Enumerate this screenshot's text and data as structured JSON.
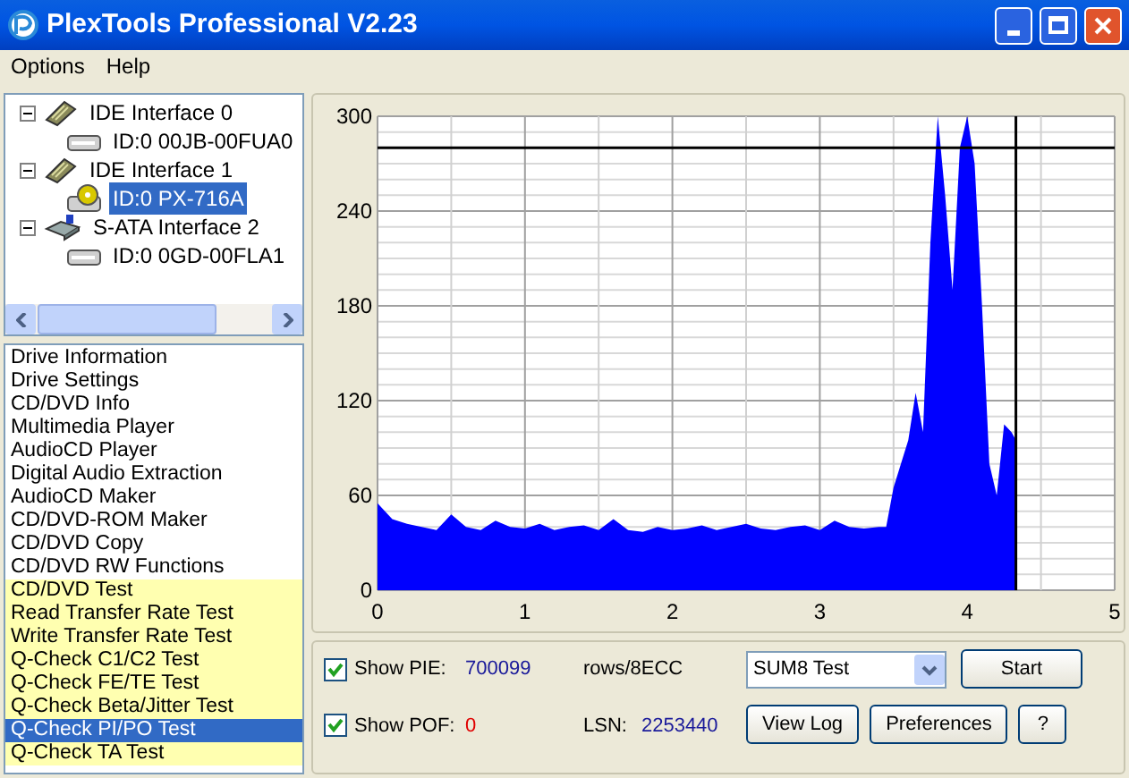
{
  "window": {
    "title": "PlexTools Professional V2.23"
  },
  "menu": [
    "Options",
    "Help"
  ],
  "tree": [
    {
      "label": "IDE Interface 0",
      "kind": "ide",
      "expanded": true,
      "children": [
        {
          "label": "ID:0  00JB-00FUA0",
          "kind": "disk",
          "selected": false
        }
      ]
    },
    {
      "label": "IDE Interface 1",
      "kind": "ide",
      "expanded": true,
      "children": [
        {
          "label": "ID:0  PX-716A",
          "kind": "optical",
          "selected": true
        }
      ]
    },
    {
      "label": "S-ATA Interface 2",
      "kind": "sata",
      "expanded": true,
      "children": [
        {
          "label": "ID:0  0GD-00FLA1",
          "kind": "disk",
          "selected": false
        }
      ]
    }
  ],
  "functions": [
    {
      "label": "Drive Information",
      "highlighted": false,
      "selected": false
    },
    {
      "label": "Drive Settings",
      "highlighted": false,
      "selected": false
    },
    {
      "label": "CD/DVD Info",
      "highlighted": false,
      "selected": false
    },
    {
      "label": "Multimedia Player",
      "highlighted": false,
      "selected": false
    },
    {
      "label": "AudioCD Player",
      "highlighted": false,
      "selected": false
    },
    {
      "label": "Digital Audio Extraction",
      "highlighted": false,
      "selected": false
    },
    {
      "label": "AudioCD Maker",
      "highlighted": false,
      "selected": false
    },
    {
      "label": "CD/DVD-ROM Maker",
      "highlighted": false,
      "selected": false
    },
    {
      "label": "CD/DVD Copy",
      "highlighted": false,
      "selected": false
    },
    {
      "label": "CD/DVD RW Functions",
      "highlighted": false,
      "selected": false
    },
    {
      "label": "CD/DVD Test",
      "highlighted": true,
      "selected": false
    },
    {
      "label": "Read Transfer Rate Test",
      "highlighted": true,
      "selected": false
    },
    {
      "label": "Write Transfer Rate Test",
      "highlighted": true,
      "selected": false
    },
    {
      "label": "Q-Check C1/C2 Test",
      "highlighted": true,
      "selected": false
    },
    {
      "label": "Q-Check FE/TE Test",
      "highlighted": true,
      "selected": false
    },
    {
      "label": "Q-Check Beta/Jitter Test",
      "highlighted": true,
      "selected": false
    },
    {
      "label": "Q-Check PI/PO Test",
      "selected": true
    },
    {
      "label": "Q-Check TA Test",
      "highlighted": true,
      "selected": false
    }
  ],
  "chart_data": {
    "type": "area",
    "x": [
      0,
      0.1,
      0.2,
      0.3,
      0.4,
      0.5,
      0.6,
      0.7,
      0.8,
      0.9,
      1,
      1.1,
      1.2,
      1.3,
      1.4,
      1.5,
      1.6,
      1.7,
      1.8,
      1.9,
      2,
      2.1,
      2.2,
      2.3,
      2.4,
      2.5,
      2.6,
      2.7,
      2.8,
      2.9,
      3,
      3.1,
      3.2,
      3.3,
      3.4,
      3.45,
      3.5,
      3.55,
      3.6,
      3.65,
      3.7,
      3.75,
      3.8,
      3.85,
      3.9,
      3.95,
      4,
      4.05,
      4.1,
      4.15,
      4.2,
      4.25,
      4.3,
      4.33
    ],
    "series": [
      {
        "color": "#0000ff",
        "values": [
          55,
          45,
          42,
          40,
          38,
          48,
          40,
          38,
          44,
          40,
          39,
          42,
          38,
          40,
          41,
          38,
          45,
          38,
          37,
          40,
          38,
          39,
          41,
          38,
          40,
          42,
          39,
          38,
          40,
          41,
          38,
          44,
          40,
          39,
          40,
          40,
          65,
          80,
          95,
          125,
          100,
          220,
          300,
          250,
          190,
          280,
          300,
          270,
          180,
          80,
          60,
          105,
          100,
          95
        ]
      }
    ],
    "xlim": [
      0,
      5
    ],
    "ylim": [
      0,
      300
    ],
    "xticks": [
      0,
      1,
      2,
      3,
      4,
      5
    ],
    "yticks": [
      0,
      60,
      120,
      180,
      240,
      300
    ],
    "grid": true,
    "ref_lines": [
      {
        "axis": "y",
        "value": 280
      },
      {
        "axis": "x",
        "value": 4.33
      }
    ]
  },
  "controls": {
    "show_pie": {
      "label": "Show PIE:",
      "checked": true,
      "value": "700099",
      "unit": "rows/8ECC"
    },
    "show_pof": {
      "label": "Show POF:",
      "checked": true,
      "value": "0"
    },
    "lsn": {
      "label": "LSN:",
      "value": "2253440"
    },
    "test_select": {
      "value": "SUM8 Test"
    },
    "buttons": [
      "Start",
      "View Log",
      "Preferences",
      "?"
    ]
  }
}
